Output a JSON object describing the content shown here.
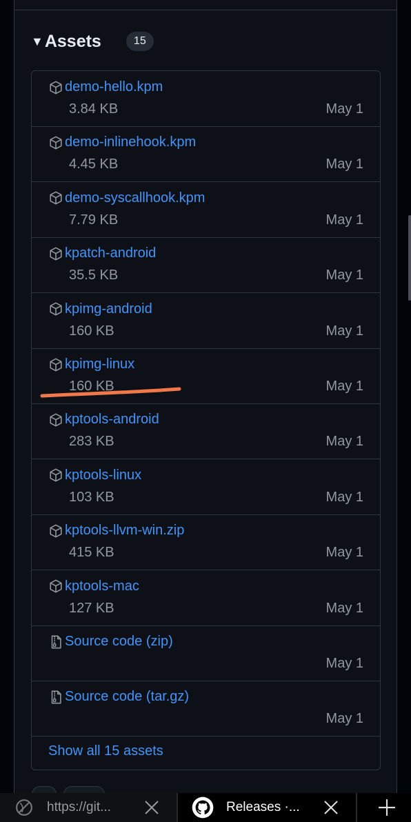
{
  "assets": {
    "title": "Assets",
    "count": "15",
    "items": [
      {
        "name": "demo-hello.kpm",
        "size": "3.84 KB",
        "date": "May 1",
        "icon": "package-icon"
      },
      {
        "name": "demo-inlinehook.kpm",
        "size": "4.45 KB",
        "date": "May 1",
        "icon": "package-icon"
      },
      {
        "name": "demo-syscallhook.kpm",
        "size": "7.79 KB",
        "date": "May 1",
        "icon": "package-icon"
      },
      {
        "name": "kpatch-android",
        "size": "35.5 KB",
        "date": "May 1",
        "icon": "package-icon"
      },
      {
        "name": "kpimg-android",
        "size": "160 KB",
        "date": "May 1",
        "icon": "package-icon"
      },
      {
        "name": "kpimg-linux",
        "size": "160 KB",
        "date": "May 1",
        "icon": "package-icon"
      },
      {
        "name": "kptools-android",
        "size": "283 KB",
        "date": "May 1",
        "icon": "package-icon"
      },
      {
        "name": "kptools-linux",
        "size": "103 KB",
        "date": "May 1",
        "icon": "package-icon"
      },
      {
        "name": "kptools-llvm-win.zip",
        "size": "415 KB",
        "date": "May 1",
        "icon": "package-icon"
      },
      {
        "name": "kptools-mac",
        "size": "127 KB",
        "date": "May 1",
        "icon": "package-icon"
      },
      {
        "name": "Source code (zip)",
        "size": "",
        "date": "May 1",
        "icon": "file-zip-icon"
      },
      {
        "name": "Source code (tar.gz)",
        "size": "",
        "date": "May 1",
        "icon": "file-zip-icon"
      }
    ],
    "show_all": "Show all 15 assets"
  },
  "tabs": [
    {
      "label": "https://git...",
      "icon": "globe-icon"
    },
    {
      "label": "Releases ·...",
      "icon": "github-icon"
    }
  ],
  "colors": {
    "link": "#4493f8",
    "muted": "#9198a1",
    "highlight": "#f0784a",
    "background": "#0d1117"
  }
}
